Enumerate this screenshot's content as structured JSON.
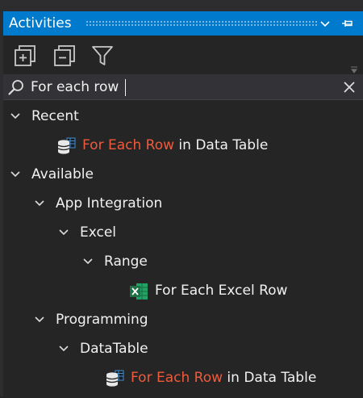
{
  "panel": {
    "title": "Activities"
  },
  "search": {
    "value": "For each row"
  },
  "tree": {
    "recent": {
      "label": "Recent",
      "items": [
        {
          "highlight": "For Each Row",
          "rest": " in Data Table",
          "icon": "datatable-icon"
        }
      ]
    },
    "available": {
      "label": "Available",
      "app_integration": {
        "label": "App Integration",
        "excel": {
          "label": "Excel",
          "range": {
            "label": "Range",
            "item": {
              "text": "For Each Excel Row",
              "icon": "excel-icon"
            }
          }
        }
      },
      "programming": {
        "label": "Programming",
        "datatable": {
          "label": "DataTable",
          "item": {
            "highlight": "For Each Row",
            "rest": " in Data Table",
            "icon": "datatable-icon"
          }
        }
      }
    }
  },
  "colors": {
    "accent": "#007acc",
    "highlight": "#f05a3b",
    "background": "#252526",
    "excel_green": "#1e7145"
  }
}
